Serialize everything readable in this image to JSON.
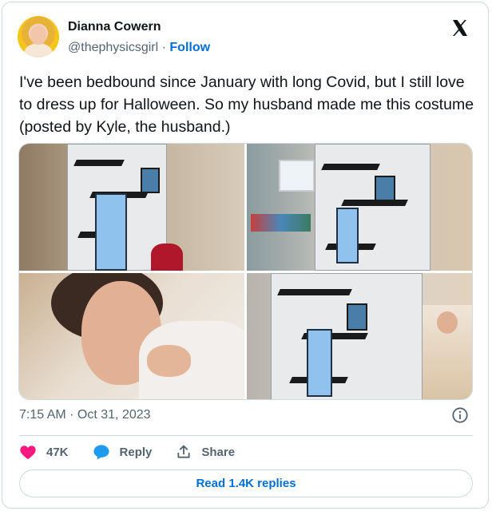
{
  "author": {
    "name": "Dianna Cowern",
    "handle": "@thephysicsgirl",
    "separator": "·",
    "follow_label": "Follow"
  },
  "tweet": {
    "text": "I've been bedbound since January with long Covid, but I still love to dress up for Halloween. So my husband made me this costume (posted by Kyle, the husband.)",
    "timestamp": "7:15 AM · Oct 31, 2023"
  },
  "actions": {
    "likes": "47K",
    "reply_label": "Reply",
    "share_label": "Share"
  },
  "read_replies_label": "Read 1.4K replies",
  "colors": {
    "like": "#f91880",
    "reply": "#1d9bf0",
    "link": "#006fd6",
    "text": "#0f1419",
    "muted": "#536471",
    "border": "#cfd9de"
  },
  "icons": [
    "x-logo-icon",
    "info-icon",
    "heart-icon",
    "reply-bubble-icon",
    "share-icon"
  ]
}
